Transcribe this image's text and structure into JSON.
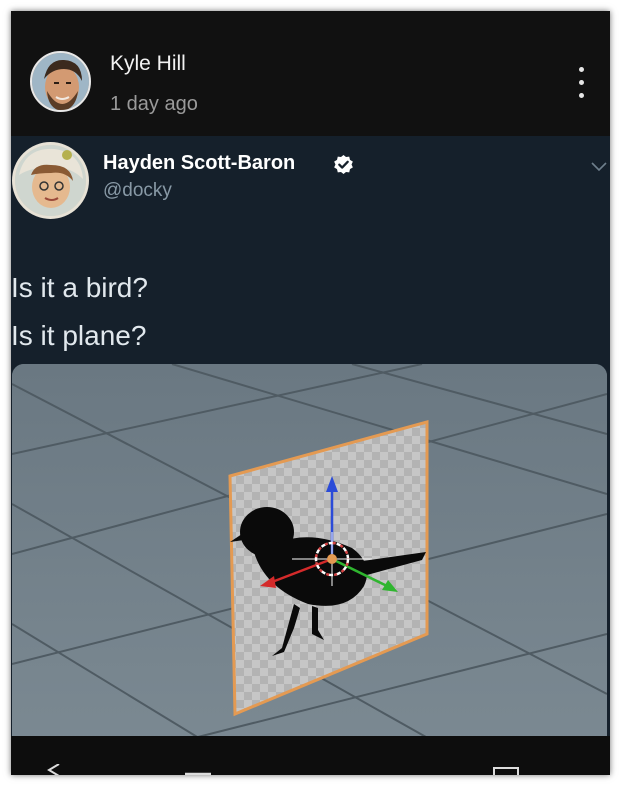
{
  "post": {
    "author_name": "Kyle Hill",
    "time_ago": "1 day ago",
    "menu_icon": "vertical-dots-icon"
  },
  "tweet": {
    "display_name": "Hayden Scott-Baron",
    "handle": "@docky",
    "verified_icon": "verified-badge-icon",
    "lines": [
      "Is it a bird?",
      "Is it plane?"
    ],
    "media_icon": "3d-viewport-bird-plane"
  },
  "nav": {
    "icons": [
      "back-icon",
      "home-icon",
      "recents-icon"
    ]
  },
  "colors": {
    "header_bg": "#111111",
    "tweet_bg": "#15202b",
    "handle": "#8899a6",
    "verified": "#ffffff",
    "plane_outline": "#e49a52"
  }
}
